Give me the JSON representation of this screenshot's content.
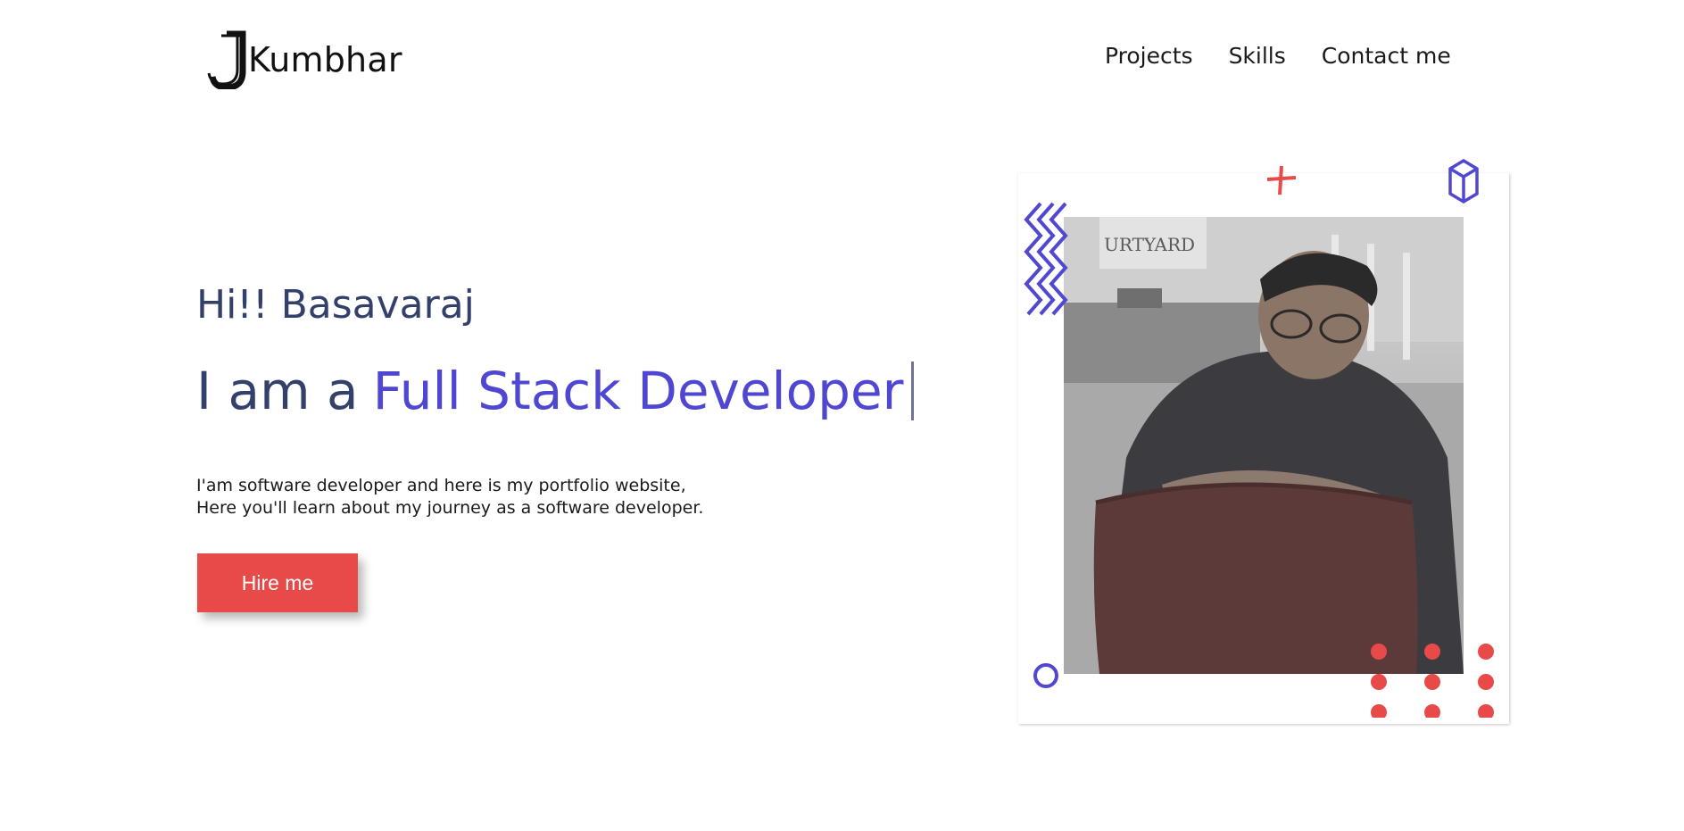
{
  "header": {
    "logo_letter": "J",
    "logo_text": "Kumbhar",
    "nav": [
      {
        "label": "Projects"
      },
      {
        "label": "Skills"
      },
      {
        "label": "Contact me"
      }
    ]
  },
  "hero": {
    "greeting": "Hi!! Basavaraj",
    "headline_prefix": "I am a",
    "headline_role": "Full Stack Developer",
    "description_line1": "I'am software developer and here is my portfolio website,",
    "description_line2": "Here you'll learn about my journey as a software developer.",
    "cta_label": "Hire me"
  },
  "photo": {
    "background_sign": "URTYARD"
  },
  "colors": {
    "text_dark": "#33406b",
    "accent_purple": "#4f46d1",
    "accent_red": "#e84a4a"
  }
}
